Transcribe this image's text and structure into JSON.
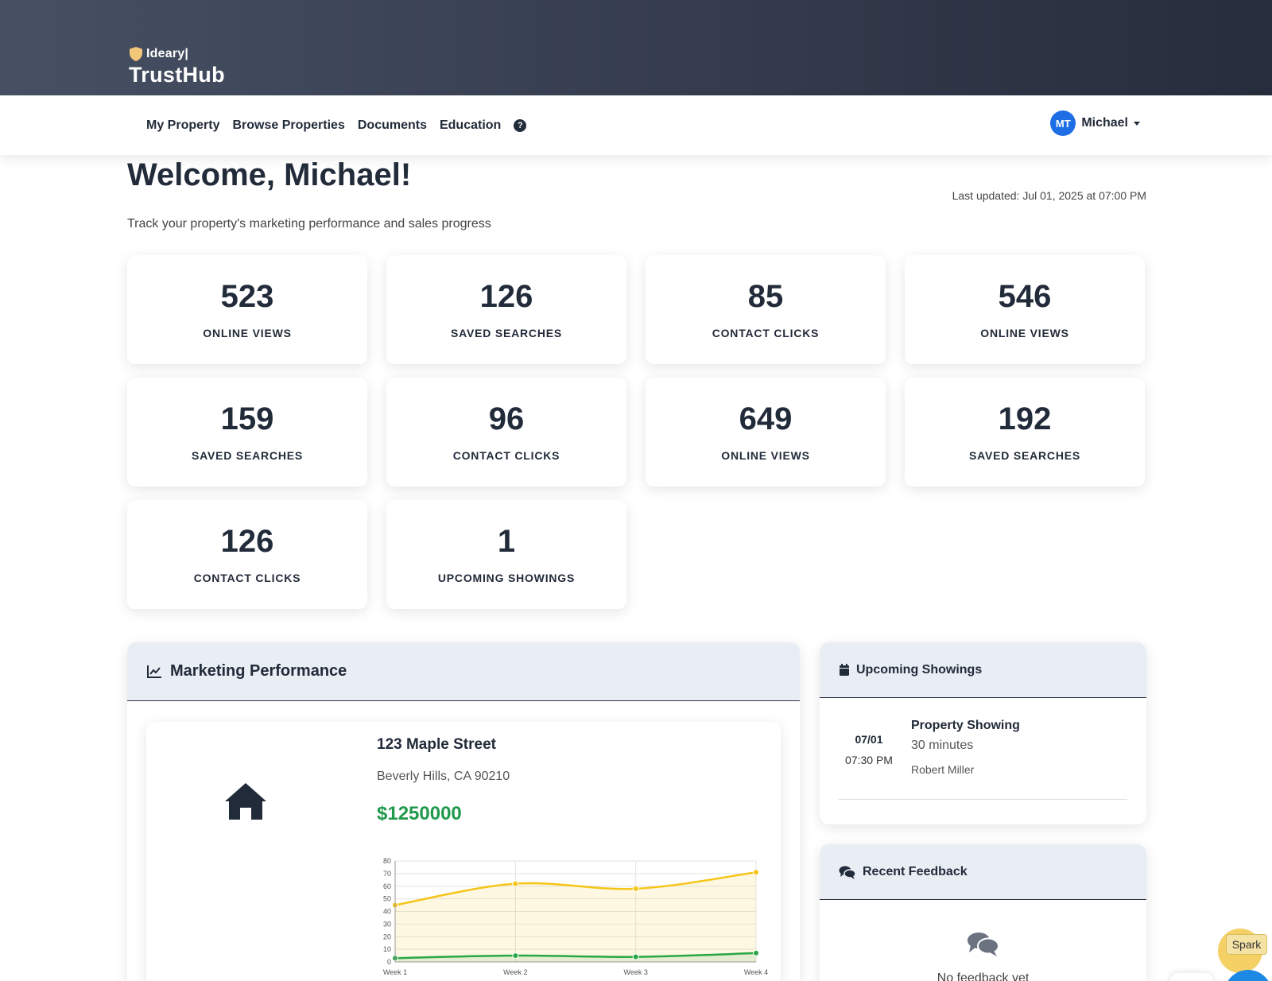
{
  "brand": {
    "small": "Ideary|",
    "big": "TrustHub"
  },
  "nav": {
    "links": [
      "My Property",
      "Browse Properties",
      "Documents",
      "Education"
    ],
    "help_icon": "question-circle-icon"
  },
  "user": {
    "initials": "MT",
    "name": "Michael"
  },
  "welcome": "Welcome, Michael!",
  "last_updated": "Last updated: Jul 01, 2025 at 07:00 PM",
  "subtitle": "Track your property's marketing performance and sales progress",
  "stats": [
    {
      "value": "523",
      "label": "ONLINE VIEWS"
    },
    {
      "value": "126",
      "label": "SAVED SEARCHES"
    },
    {
      "value": "85",
      "label": "CONTACT CLICKS"
    },
    {
      "value": "546",
      "label": "ONLINE VIEWS"
    },
    {
      "value": "159",
      "label": "SAVED SEARCHES"
    },
    {
      "value": "96",
      "label": "CONTACT CLICKS"
    },
    {
      "value": "649",
      "label": "ONLINE VIEWS"
    },
    {
      "value": "192",
      "label": "SAVED SEARCHES"
    },
    {
      "value": "126",
      "label": "CONTACT CLICKS"
    },
    {
      "value": "1",
      "label": "UPCOMING SHOWINGS"
    }
  ],
  "marketing": {
    "title": "Marketing Performance",
    "property": {
      "street": "123 Maple Street",
      "city": "Beverly Hills, CA 90210",
      "price": "$1250000"
    }
  },
  "chart_data": {
    "type": "line",
    "categories": [
      "Week 1",
      "Week 2",
      "Week 3",
      "Week 4"
    ],
    "ylim": [
      0,
      80
    ],
    "yticks": [
      0,
      10,
      20,
      30,
      40,
      50,
      60,
      70,
      80
    ],
    "grid": true,
    "series": [
      {
        "color": "#f5c518",
        "values": [
          45,
          62,
          58,
          71
        ]
      },
      {
        "color": "#28a745",
        "values": [
          3,
          5,
          4,
          7
        ]
      }
    ]
  },
  "showings": {
    "title": "Upcoming Showings",
    "items": [
      {
        "date": "07/01",
        "time": "07:30 PM",
        "title": "Property Showing",
        "duration": "30 minutes",
        "agent": "Robert Miller"
      }
    ]
  },
  "feedback": {
    "title": "Recent Feedback",
    "empty": "No feedback yet"
  },
  "spark": {
    "label": "Spark"
  }
}
